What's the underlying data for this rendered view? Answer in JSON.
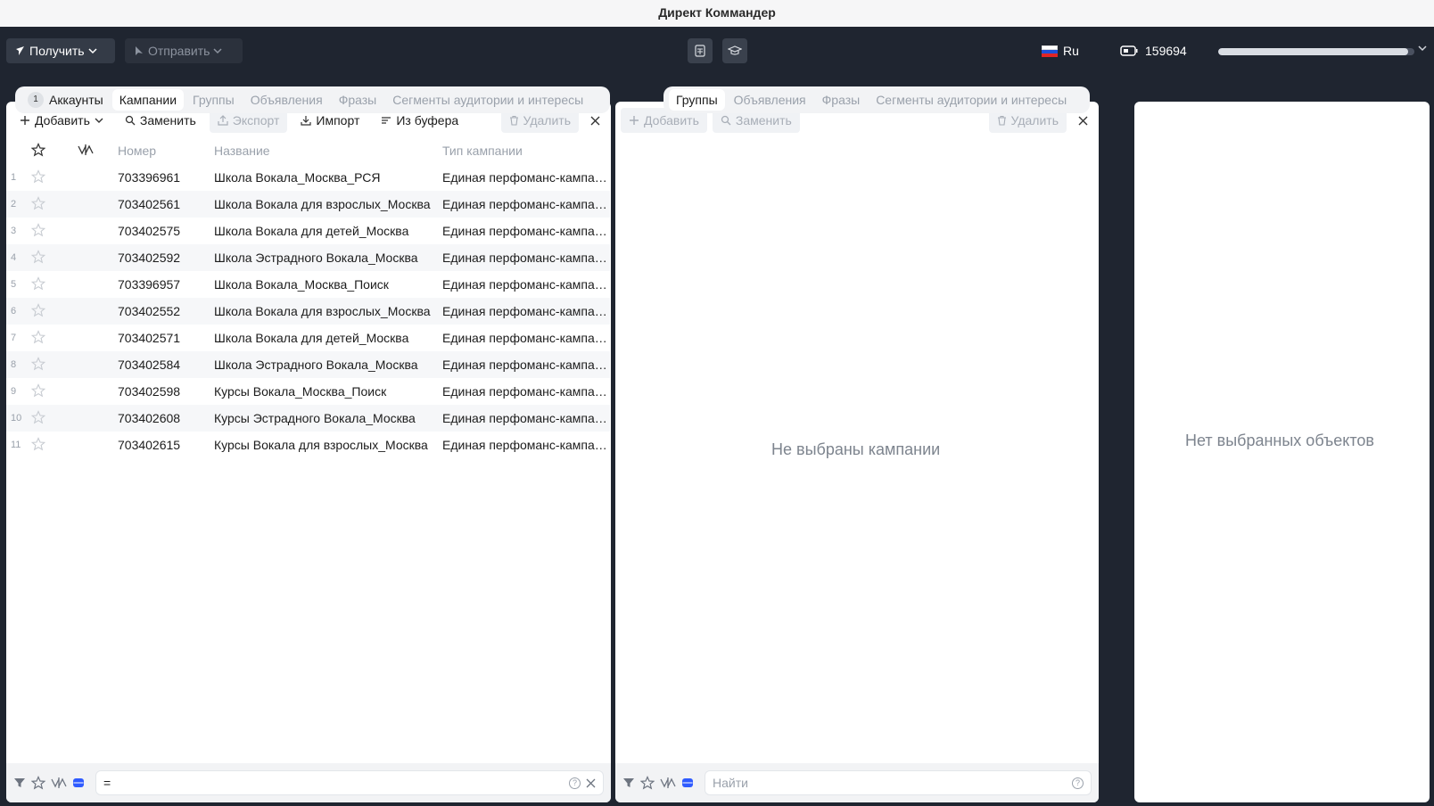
{
  "window": {
    "title": "Директ Коммандер"
  },
  "topbar": {
    "get_label": "Получить",
    "send_label": "Отправить",
    "lang_label": "Ru",
    "balance": "159694",
    "progress_fraction": 0.97,
    "colors": {
      "bg": "#1f2530",
      "button": "#343b47"
    }
  },
  "left_tabs": [
    {
      "label": "Аккаунты",
      "count": "1",
      "state": "dark"
    },
    {
      "label": "Кампании",
      "state": "active"
    },
    {
      "label": "Группы",
      "state": "inactive"
    },
    {
      "label": "Объявления",
      "state": "inactive"
    },
    {
      "label": "Фразы",
      "state": "inactive"
    },
    {
      "label": "Сегменты аудитории и интересы",
      "state": "inactive"
    }
  ],
  "left_toolbar": {
    "add": "Добавить",
    "replace": "Заменить",
    "export": "Экспорт",
    "import": "Импорт",
    "from_buffer": "Из буфера",
    "delete": "Удалить"
  },
  "campaign_table": {
    "columns": {
      "number": "Номер",
      "name": "Название",
      "type": "Тип кампании"
    },
    "rows": [
      {
        "idx": "1",
        "number": "703396961",
        "name": "Школа Вокала_Москва_РСЯ",
        "type": "Единая перфоманс-кампания"
      },
      {
        "idx": "2",
        "number": "703402561",
        "name": "Школа Вокала для взрослых_Москва",
        "type": "Единая перфоманс-кампания"
      },
      {
        "idx": "3",
        "number": "703402575",
        "name": "Школа Вокала для детей_Москва",
        "type": "Единая перфоманс-кампания"
      },
      {
        "idx": "4",
        "number": "703402592",
        "name": "Школа Эстрадного Вокала_Москва",
        "type": "Единая перфоманс-кампания"
      },
      {
        "idx": "5",
        "number": "703396957",
        "name": "Школа Вокала_Москва_Поиск",
        "type": "Единая перфоманс-кампания"
      },
      {
        "idx": "6",
        "number": "703402552",
        "name": "Школа Вокала для взрослых_Москва",
        "type": "Единая перфоманс-кампания"
      },
      {
        "idx": "7",
        "number": "703402571",
        "name": "Школа Вокала для детей_Москва",
        "type": "Единая перфоманс-кампания"
      },
      {
        "idx": "8",
        "number": "703402584",
        "name": "Школа Эстрадного Вокала_Москва",
        "type": "Единая перфоманс-кампания"
      },
      {
        "idx": "9",
        "number": "703402598",
        "name": "Курсы Вокала_Москва_Поиск",
        "type": "Единая перфоманс-кампания"
      },
      {
        "idx": "10",
        "number": "703402608",
        "name": "Курсы Эстрадного Вокала_Москва",
        "type": "Единая перфоманс-кампания"
      },
      {
        "idx": "11",
        "number": "703402615",
        "name": "Курсы Вокала для взрослых_Москва",
        "type": "Единая перфоманс-кампания"
      }
    ]
  },
  "left_filter": {
    "value": "="
  },
  "right_tabs": [
    {
      "label": "Группы",
      "state": "active"
    },
    {
      "label": "Объявления",
      "state": "inactive"
    },
    {
      "label": "Фразы",
      "state": "inactive"
    },
    {
      "label": "Сегменты аудитории и интересы",
      "state": "inactive"
    }
  ],
  "right_toolbar": {
    "add": "Добавить",
    "replace": "Заменить",
    "delete": "Удалить"
  },
  "right_panel": {
    "empty_message": "Не выбраны кампании",
    "search_placeholder": "Найти"
  },
  "details_panel": {
    "empty_message": "Нет выбранных объектов"
  }
}
